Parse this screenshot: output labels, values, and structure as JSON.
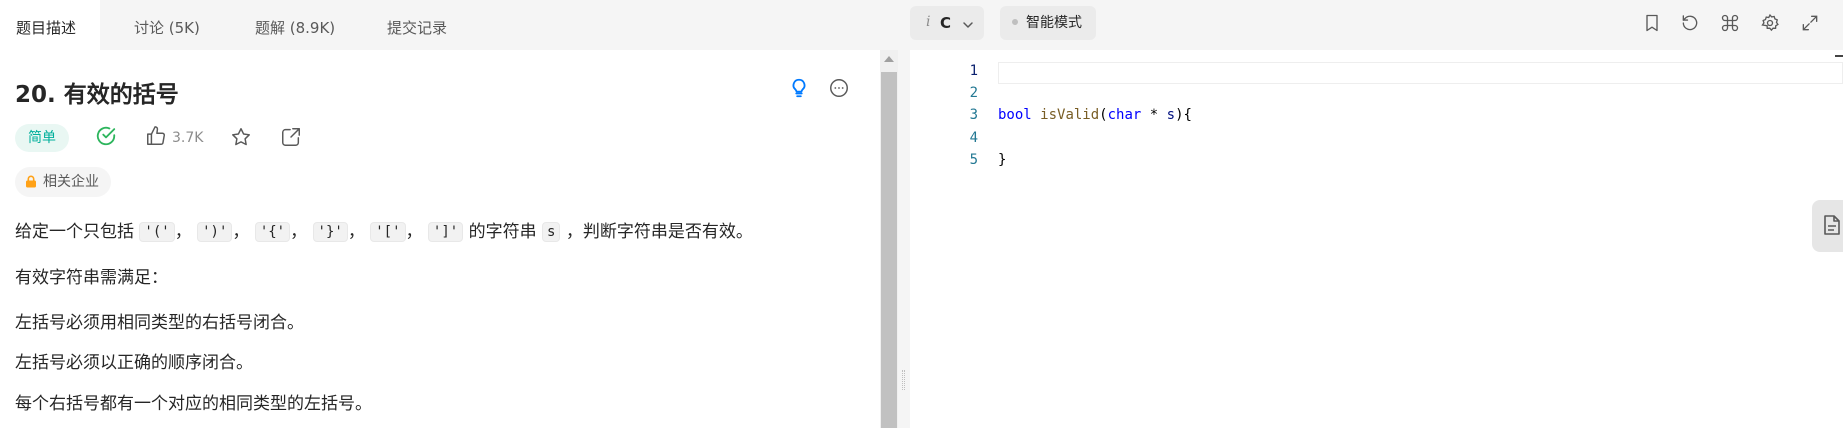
{
  "tabs": [
    {
      "label": "题目描述"
    },
    {
      "label": "讨论 (5K)"
    },
    {
      "label": "题解 (8.9K)"
    },
    {
      "label": "提交记录"
    }
  ],
  "problem": {
    "title": "20. 有效的括号",
    "difficulty": "简单",
    "likes": "3.7K",
    "companies_label": "相关企业"
  },
  "description": {
    "intro_prefix": "给定一个只包括",
    "chars": [
      "'('",
      "')'",
      "'{'",
      "'}'",
      "'['",
      "']'"
    ],
    "sep": "，",
    "intro_mid": "的字符串",
    "var": "s",
    "intro_suffix": "，判断字符串是否有效。",
    "rules_heading": "有效字符串需满足：",
    "rules": [
      "左括号必须用相同类型的右括号闭合。",
      "左括号必须以正确的顺序闭合。",
      "每个右括号都有一个对应的相同类型的左括号。"
    ]
  },
  "editor": {
    "language": "C",
    "smart_mode_label": "智能模式",
    "line_numbers": [
      "1",
      "2",
      "3",
      "4",
      "5"
    ],
    "code": {
      "kw_bool": "bool",
      "fn_name": "isValid",
      "open_paren": "(",
      "kw_char": "char",
      "star": " * ",
      "param": "s",
      "close": "){",
      "closing_brace": "}"
    }
  },
  "colors": {
    "easy_text": "#00af9b",
    "easy_bg": "#e9f7f3",
    "solved": "#2db55d",
    "hint": "#007aff",
    "lock": "#ffa116",
    "line_number": "#237893",
    "keyword": "#0000ff",
    "function": "#795e26"
  },
  "icons": {
    "hint": "lightbulb-icon",
    "more": "ellipsis-icon",
    "solved": "check-circle-icon",
    "like": "thumbs-up-icon",
    "star": "star-icon",
    "share": "share-icon",
    "lock": "lock-icon",
    "bookmark": "bookmark-icon",
    "reset": "reset-icon",
    "shortcut": "command-icon",
    "settings": "gear-icon",
    "expand": "expand-icon",
    "note": "document-icon"
  }
}
